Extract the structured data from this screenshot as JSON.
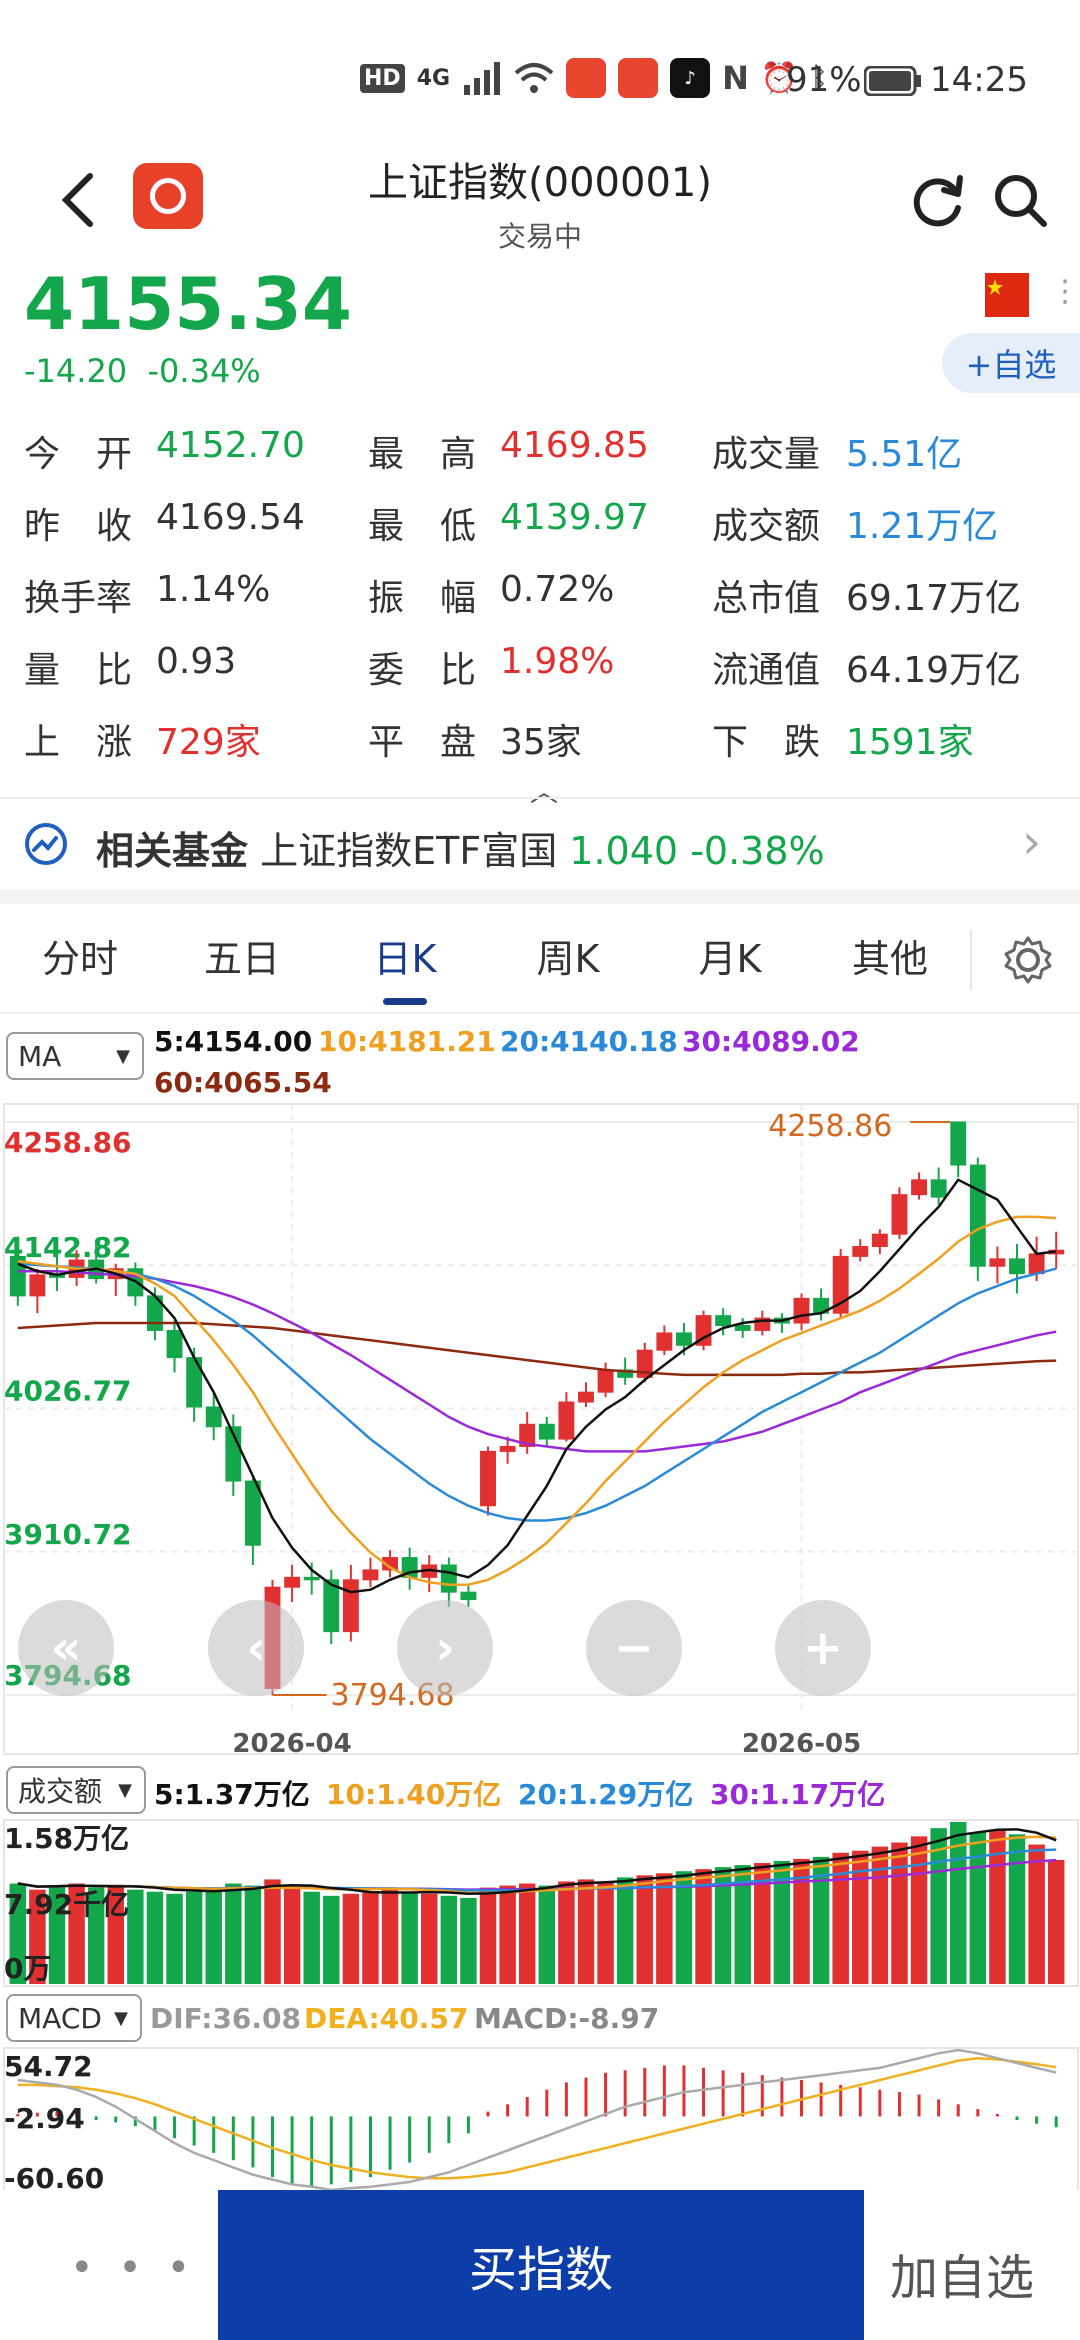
{
  "status": {
    "network": "4G",
    "hd": "HD",
    "battery": "91%",
    "time": "14:25"
  },
  "header": {
    "title": "上证指数(000001)",
    "subtitle": "交易中",
    "icons": [
      "back-icon",
      "refresh-icon",
      "search-icon"
    ]
  },
  "quote": {
    "price": "4155.34",
    "change": "-14.20",
    "change_pct": "-0.34%",
    "add_watch": "+自选"
  },
  "stats": [
    {
      "label": "今　开",
      "value": "4152.70",
      "color": "green"
    },
    {
      "label": "最　高",
      "value": "4169.85",
      "color": "red"
    },
    {
      "label": "成交量",
      "value": "5.51亿",
      "color": "blue"
    },
    {
      "label": "昨　收",
      "value": "4169.54",
      "color": "dark"
    },
    {
      "label": "最　低",
      "value": "4139.97",
      "color": "green"
    },
    {
      "label": "成交额",
      "value": "1.21万亿",
      "color": "blue"
    },
    {
      "label": "换手率",
      "value": "1.14%",
      "color": "dark"
    },
    {
      "label": "振　幅",
      "value": "0.72%",
      "color": "dark"
    },
    {
      "label": "总市值",
      "value": "69.17万亿",
      "color": "dark"
    },
    {
      "label": "量　比",
      "value": "0.93",
      "color": "dark"
    },
    {
      "label": "委　比",
      "value": "1.98%",
      "color": "red"
    },
    {
      "label": "流通值",
      "value": "64.19万亿",
      "color": "dark"
    },
    {
      "label": "上　涨",
      "value": "729家",
      "color": "red"
    },
    {
      "label": "平　盘",
      "value": "35家",
      "color": "dark"
    },
    {
      "label": "下　跌",
      "value": "1591家",
      "color": "green"
    }
  ],
  "fund": {
    "label": "相关基金",
    "name": "上证指数ETF富国",
    "price": "1.040",
    "pct": "-0.38%"
  },
  "tabs": [
    "分时",
    "五日",
    "日K",
    "周K",
    "月K",
    "其他"
  ],
  "active_tab": "日K",
  "ma": {
    "selector": "MA",
    "ma5": "5:4154.00",
    "ma10": "10:4181.21",
    "ma20": "20:4140.18",
    "ma30": "30:4089.02",
    "ma60": "60:4065.54"
  },
  "volume": {
    "selector": "成交额",
    "ma5": "5:1.37万亿",
    "ma10": "10:1.40万亿",
    "ma20": "20:1.29万亿",
    "ma30": "30:1.17万亿",
    "axis_top": "1.58万亿",
    "axis_mid": "7.92千亿",
    "axis_bottom": "0万"
  },
  "macd": {
    "selector": "MACD",
    "dif": "DIF:36.08",
    "dea": "DEA:40.57",
    "macd": "MACD:-8.97",
    "axis_top": "54.72",
    "axis_mid": "-2.94",
    "axis_bottom": "-60.60"
  },
  "bottom": {
    "more": "• • •",
    "buy": "买指数",
    "add": "加自选"
  },
  "colors": {
    "up": "#e03030",
    "down": "#14a64b",
    "ma5": "#111111",
    "ma10": "#f0a020",
    "ma20": "#2a8ad8",
    "ma30": "#9a2ad8",
    "ma60": "#8b2a10",
    "accent": "#0d3da8"
  },
  "chart_data": {
    "type": "candlestick",
    "y_axis_labels": [
      "4258.86",
      "4142.82",
      "4026.77",
      "3910.72",
      "3794.68"
    ],
    "ylim": [
      3794.68,
      4258.86
    ],
    "x_axis_labels": [
      "2026-04",
      "2026-05"
    ],
    "max_annotation": "4258.86",
    "min_annotation": "3794.68",
    "candles": [
      [
        4150,
        4118,
        4166,
        4110
      ],
      [
        4118,
        4135,
        4140,
        4104
      ],
      [
        4135,
        4133,
        4153,
        4122
      ],
      [
        4133,
        4147,
        4155,
        4126
      ],
      [
        4147,
        4132,
        4160,
        4128
      ],
      [
        4132,
        4140,
        4144,
        4118
      ],
      [
        4140,
        4118,
        4145,
        4110
      ],
      [
        4118,
        4090,
        4125,
        4082
      ],
      [
        4090,
        4068,
        4098,
        4056
      ],
      [
        4068,
        4028,
        4076,
        4016
      ],
      [
        4028,
        4012,
        4040,
        4001
      ],
      [
        4012,
        3968,
        4022,
        3956
      ],
      [
        3968,
        3916,
        3972,
        3900
      ],
      [
        3800,
        3882,
        3888,
        3794.68
      ],
      [
        3882,
        3890,
        3900,
        3870
      ],
      [
        3890,
        3888,
        3902,
        3876
      ],
      [
        3888,
        3846,
        3896,
        3836
      ],
      [
        3846,
        3888,
        3900,
        3838
      ],
      [
        3888,
        3896,
        3906,
        3882
      ],
      [
        3896,
        3906,
        3912,
        3890
      ],
      [
        3906,
        3890,
        3914,
        3880
      ],
      [
        3890,
        3900,
        3908,
        3878
      ],
      [
        3900,
        3878,
        3906,
        3866
      ],
      [
        3878,
        3872,
        3884,
        3866
      ],
      [
        3948,
        3992,
        3996,
        3940
      ],
      [
        3992,
        3996,
        4004,
        3982
      ],
      [
        3996,
        4014,
        4024,
        3990
      ],
      [
        4014,
        4002,
        4020,
        3996
      ],
      [
        4002,
        4032,
        4040,
        4000
      ],
      [
        4032,
        4040,
        4048,
        4028
      ],
      [
        4040,
        4058,
        4064,
        4036
      ],
      [
        4058,
        4052,
        4068,
        4046
      ],
      [
        4052,
        4074,
        4080,
        4048
      ],
      [
        4074,
        4088,
        4094,
        4070
      ],
      [
        4088,
        4078,
        4096,
        4070
      ],
      [
        4078,
        4102,
        4106,
        4074
      ],
      [
        4102,
        4094,
        4108,
        4086
      ],
      [
        4094,
        4090,
        4100,
        4084
      ],
      [
        4090,
        4100,
        4106,
        4086
      ],
      [
        4100,
        4096,
        4104,
        4088
      ],
      [
        4096,
        4116,
        4120,
        4090
      ],
      [
        4116,
        4104,
        4124,
        4098
      ],
      [
        4104,
        4150,
        4156,
        4100
      ],
      [
        4150,
        4158,
        4164,
        4146
      ],
      [
        4158,
        4168,
        4172,
        4152
      ],
      [
        4168,
        4200,
        4206,
        4164
      ],
      [
        4200,
        4212,
        4218,
        4196
      ],
      [
        4212,
        4198,
        4222,
        4192
      ],
      [
        4258.86,
        4224,
        4258.86,
        4214
      ],
      [
        4224,
        4142,
        4230,
        4130
      ],
      [
        4142,
        4148,
        4158,
        4128
      ],
      [
        4148,
        4136,
        4160,
        4120
      ],
      [
        4136,
        4152,
        4166,
        4130
      ],
      [
        4152,
        4155,
        4170,
        4140
      ]
    ],
    "ma5_points": [
      4144,
      4138,
      4135,
      4138,
      4140,
      4136,
      4130,
      4118,
      4100,
      4068,
      4040,
      4006,
      3972,
      3938,
      3914,
      3896,
      3884,
      3878,
      3880,
      3888,
      3894,
      3896,
      3894,
      3890,
      3900,
      3916,
      3940,
      3964,
      3994,
      4012,
      4026,
      4036,
      4050,
      4062,
      4074,
      4084,
      4092,
      4096,
      4098,
      4098,
      4102,
      4104,
      4112,
      4122,
      4138,
      4156,
      4174,
      4190,
      4212,
      4204,
      4196,
      4174,
      4152,
      4154
    ],
    "ma10_points": [
      4146,
      4144,
      4142,
      4140,
      4140,
      4138,
      4136,
      4128,
      4118,
      4100,
      4082,
      4062,
      4040,
      4014,
      3990,
      3966,
      3944,
      3926,
      3910,
      3898,
      3890,
      3886,
      3884,
      3884,
      3888,
      3896,
      3906,
      3918,
      3934,
      3950,
      3968,
      3984,
      4000,
      4016,
      4030,
      4044,
      4056,
      4066,
      4074,
      4082,
      4088,
      4094,
      4100,
      4106,
      4114,
      4124,
      4136,
      4148,
      4162,
      4172,
      4178,
      4182,
      4182,
      4181
    ],
    "ma20_points": [
      4144,
      4143,
      4142,
      4141,
      4140,
      4138,
      4136,
      4132,
      4126,
      4118,
      4108,
      4098,
      4086,
      4072,
      4058,
      4044,
      4030,
      4016,
      4002,
      3990,
      3978,
      3966,
      3956,
      3948,
      3942,
      3938,
      3936,
      3936,
      3938,
      3942,
      3948,
      3956,
      3964,
      3974,
      3984,
      3994,
      4004,
      4014,
      4024,
      4032,
      4040,
      4048,
      4056,
      4064,
      4072,
      4082,
      4092,
      4102,
      4112,
      4120,
      4126,
      4132,
      4136,
      4140
    ],
    "ma30_points": [
      4138,
      4138,
      4138,
      4137,
      4136,
      4135,
      4134,
      4132,
      4129,
      4126,
      4122,
      4117,
      4111,
      4104,
      4096,
      4088,
      4079,
      4070,
      4060,
      4050,
      4040,
      4030,
      4020,
      4012,
      4006,
      4002,
      3998,
      3996,
      3994,
      3992,
      3992,
      3992,
      3992,
      3994,
      3996,
      3998,
      4000,
      4004,
      4008,
      4014,
      4020,
      4026,
      4032,
      4040,
      4046,
      4052,
      4058,
      4064,
      4070,
      4074,
      4078,
      4082,
      4086,
      4089
    ],
    "ma60_points": [
      4092,
      4093,
      4094,
      4095,
      4096,
      4096,
      4096,
      4096,
      4096,
      4096,
      4095,
      4094,
      4093,
      4092,
      4090,
      4088,
      4086,
      4084,
      4082,
      4080,
      4078,
      4076,
      4074,
      4072,
      4070,
      4068,
      4066,
      4064,
      4062,
      4060,
      4058,
      4057,
      4056,
      4055,
      4054,
      4054,
      4054,
      4054,
      4054,
      4054,
      4055,
      4055,
      4056,
      4056,
      4057,
      4058,
      4059,
      4060,
      4061,
      4062,
      4063,
      4064,
      4065,
      4065.54
    ],
    "volume_bars": [
      0.98,
      0.92,
      0.96,
      0.98,
      0.94,
      0.96,
      0.92,
      0.9,
      0.88,
      0.9,
      0.92,
      0.98,
      0.96,
      1.02,
      0.94,
      0.9,
      0.86,
      0.88,
      0.9,
      0.92,
      0.9,
      0.88,
      0.86,
      0.84,
      0.94,
      0.96,
      0.98,
      0.96,
      1.0,
      1.02,
      1.0,
      1.04,
      1.06,
      1.08,
      1.1,
      1.12,
      1.14,
      1.16,
      1.18,
      1.2,
      1.22,
      1.24,
      1.28,
      1.3,
      1.34,
      1.38,
      1.44,
      1.52,
      1.58,
      1.48,
      1.5,
      1.46,
      1.36,
      1.21
    ],
    "macd_bars": [
      2,
      3,
      4,
      4,
      -3,
      -5,
      -8,
      -12,
      -18,
      -24,
      -30,
      -36,
      -42,
      -50,
      -56,
      -58,
      -56,
      -54,
      -50,
      -44,
      -38,
      -30,
      -22,
      -14,
      4,
      10,
      16,
      22,
      28,
      32,
      36,
      38,
      40,
      42,
      42,
      40,
      38,
      36,
      34,
      32,
      30,
      28,
      26,
      24,
      22,
      20,
      18,
      14,
      10,
      6,
      2,
      -3,
      -6,
      -8.97
    ],
    "dif_points": [
      30,
      28,
      26,
      22,
      16,
      8,
      -2,
      -12,
      -22,
      -30,
      -36,
      -42,
      -48,
      -52,
      -56,
      -58,
      -60.6,
      -59,
      -58,
      -56,
      -54,
      -50,
      -46,
      -40,
      -34,
      -28,
      -22,
      -16,
      -10,
      -4,
      2,
      8,
      12,
      16,
      20,
      22,
      24,
      26,
      28,
      30,
      32,
      34,
      36,
      38,
      40,
      44,
      48,
      52,
      54.72,
      52,
      48,
      44,
      40,
      36.08
    ],
    "dea_points": [
      26,
      26,
      25,
      24,
      22,
      19,
      15,
      10,
      4,
      -2,
      -8,
      -14,
      -20,
      -26,
      -31,
      -36,
      -40,
      -43,
      -46,
      -48,
      -50,
      -51,
      -51,
      -50,
      -48,
      -46,
      -42,
      -38,
      -34,
      -30,
      -26,
      -22,
      -18,
      -14,
      -10,
      -6,
      -2,
      2,
      6,
      10,
      14,
      18,
      22,
      26,
      30,
      34,
      38,
      42,
      46,
      48,
      47,
      45,
      43,
      40.57
    ]
  }
}
